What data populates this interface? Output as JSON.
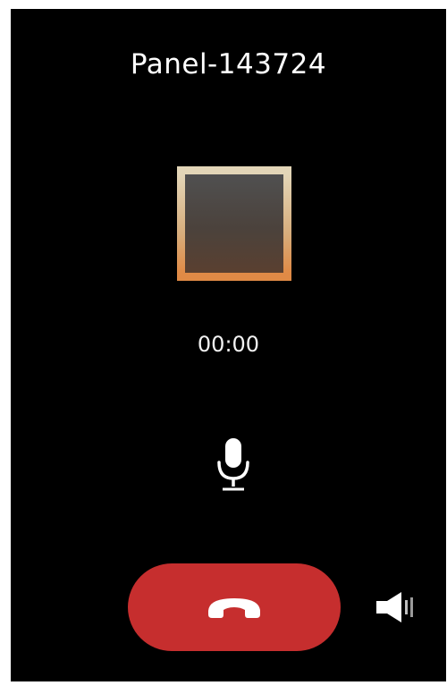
{
  "call": {
    "caller_name": "Panel-143724",
    "timer": "00:00"
  },
  "controls": {
    "mic_icon": "microphone-icon",
    "end_call_icon": "phone-hangup-icon",
    "speaker_icon": "speaker-icon",
    "end_call_color": "#c62e2e"
  }
}
